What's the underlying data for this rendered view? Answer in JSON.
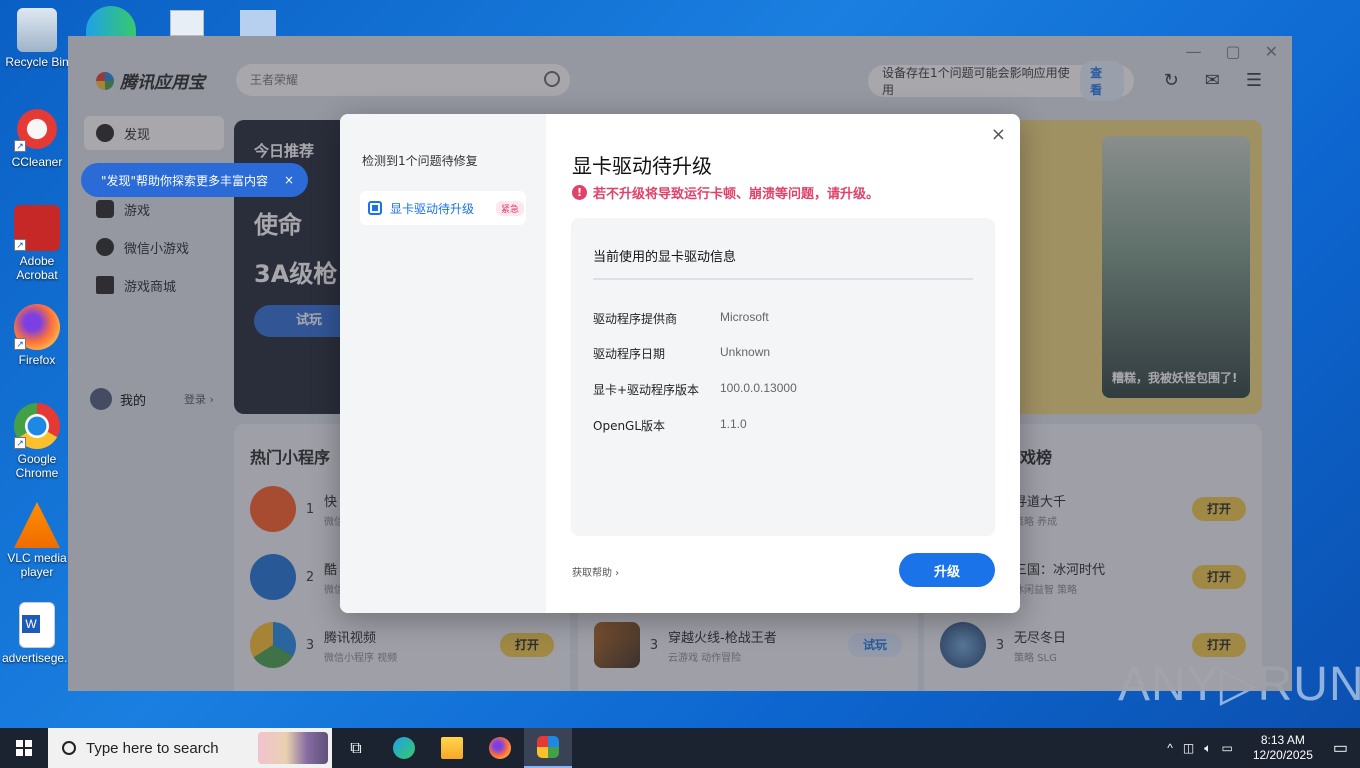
{
  "desktop": {
    "icons": [
      {
        "label": "Recycle Bin"
      },
      {
        "label": "CCleaner"
      },
      {
        "label": "Adobe Acrobat"
      },
      {
        "label": "Firefox"
      },
      {
        "label": "Google Chrome"
      },
      {
        "label": "VLC media player"
      },
      {
        "label": "advertisege..."
      }
    ]
  },
  "app": {
    "brand": "腾讯应用宝",
    "search_placeholder": "王者荣耀",
    "notice_text": "设备存在1个问题可能会影响应用使用",
    "notice_button": "查看",
    "sidebar": {
      "items": [
        {
          "label": "发现"
        },
        {
          "label": "游戏"
        },
        {
          "label": "微信小游戏"
        },
        {
          "label": "游戏商城"
        }
      ],
      "tooltip": "\"发现\"帮助你探索更多丰富内容",
      "tooltip_close": "×",
      "me_label": "我的",
      "login_label": "登录 ›"
    },
    "banner": {
      "title": "今日推荐",
      "line1": "使命",
      "line2": "3A级枪",
      "try_label": "试玩"
    },
    "poster_caption": "糟糕，我被妖怪包围了!",
    "left_panel": {
      "title": "热门小程序",
      "rows": [
        {
          "rank": "1",
          "name": "快",
          "sub": "微信",
          "button": ""
        },
        {
          "rank": "2",
          "name": "酷",
          "sub": "微信",
          "button": ""
        },
        {
          "rank": "3",
          "name": "腾讯视频",
          "sub": "微信小程序 视频",
          "button": "打开"
        }
      ]
    },
    "mid_panel": {
      "rows": [
        {
          "rank": "3",
          "name": "穿越火线-枪战王者",
          "sub": "云游戏 动作冒险",
          "button": "试玩"
        }
      ]
    },
    "right_panel": {
      "title": "戏榜",
      "rows": [
        {
          "rank": "",
          "name": "寻道大千",
          "sub": "策略 养成",
          "button": "打开"
        },
        {
          "rank": "",
          "name": "三国：冰河时代",
          "sub": "休闲益智 策略",
          "button": "打开"
        },
        {
          "rank": "3",
          "name": "无尽冬日",
          "sub": "策略 SLG",
          "button": "打开"
        }
      ]
    }
  },
  "modal": {
    "left_title": "检测到1个问题待修复",
    "issue_label": "显卡驱动待升级",
    "issue_badge": "紧急",
    "title": "显卡驱动待升级",
    "warning": "若不升级将导致运行卡顿、崩溃等问题，请升级。",
    "card_title": "当前使用的显卡驱动信息",
    "info": [
      {
        "key": "驱动程序提供商",
        "value": "Microsoft"
      },
      {
        "key": "驱动程序日期",
        "value": "Unknown"
      },
      {
        "key": "显卡+驱动程序版本",
        "value": "100.0.0.13000"
      },
      {
        "key": "OpenGL版本",
        "value": "1.1.0"
      }
    ],
    "help_label": "获取帮助 ›",
    "upgrade_label": "升级",
    "close_label": "×"
  },
  "watermark": "ANY▷RUN",
  "taskbar": {
    "search_placeholder": "Type here to search",
    "time": "8:13 AM",
    "date": "12/20/2025"
  }
}
